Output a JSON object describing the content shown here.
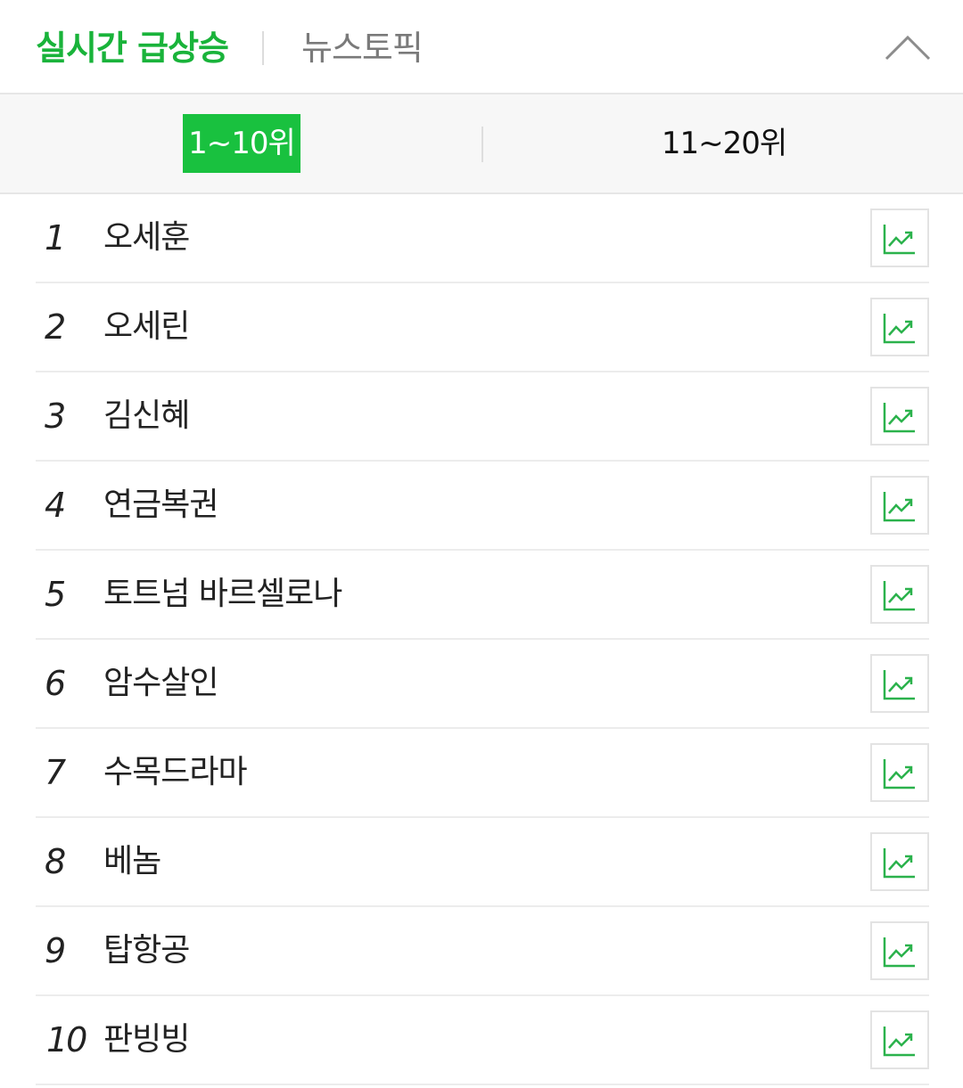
{
  "header": {
    "tabs": [
      {
        "label": "실시간 급상승",
        "active": true
      },
      {
        "label": "뉴스토픽",
        "active": false
      }
    ],
    "collapse_icon": "chevron-up-icon"
  },
  "range": {
    "options": [
      {
        "label": "1~10위",
        "active": true
      },
      {
        "label": "11~20위",
        "active": false
      }
    ]
  },
  "colors": {
    "accent": "#19b33a",
    "active_bg": "#19c13f",
    "trend_icon": "#2bb24c"
  },
  "keywords": [
    {
      "rank": "1",
      "text": "오세훈"
    },
    {
      "rank": "2",
      "text": "오세린"
    },
    {
      "rank": "3",
      "text": "김신혜"
    },
    {
      "rank": "4",
      "text": "연금복권"
    },
    {
      "rank": "5",
      "text": "토트넘 바르셀로나"
    },
    {
      "rank": "6",
      "text": "암수살인"
    },
    {
      "rank": "7",
      "text": "수목드라마"
    },
    {
      "rank": "8",
      "text": "베놈"
    },
    {
      "rank": "9",
      "text": "탑항공"
    },
    {
      "rank": "10",
      "text": "판빙빙"
    }
  ],
  "trend_icon": "trend-chart-icon"
}
